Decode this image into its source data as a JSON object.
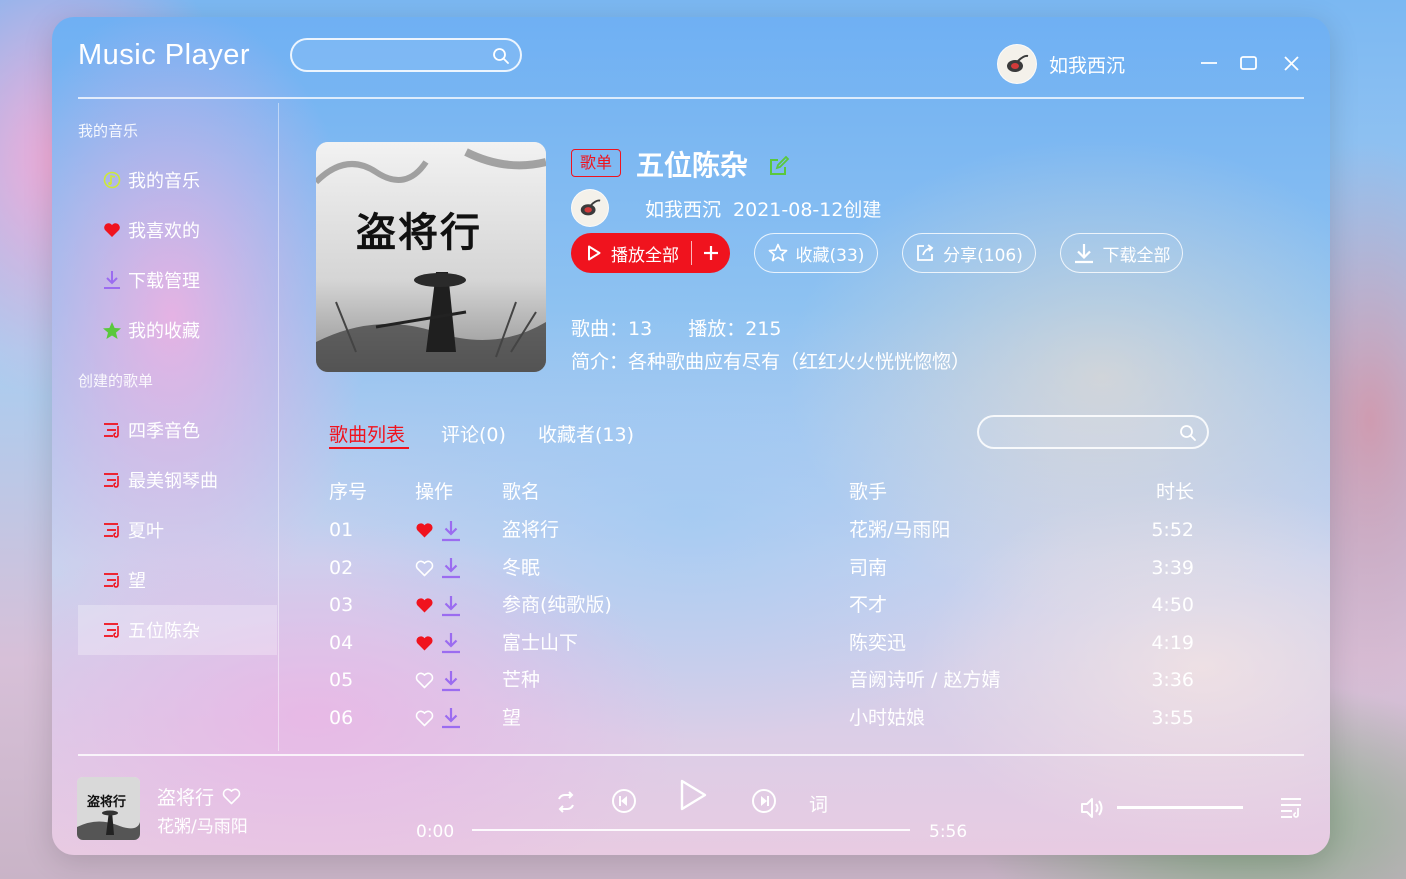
{
  "app": {
    "title": "Music Player"
  },
  "search": {
    "placeholder": ""
  },
  "user": {
    "name": "如我西沉"
  },
  "sidebar": {
    "my_music_title": "我的音乐",
    "items": [
      {
        "label": "我的音乐",
        "icon": "music-note-icon"
      },
      {
        "label": "我喜欢的",
        "icon": "heart-icon"
      },
      {
        "label": "下载管理",
        "icon": "download-icon"
      },
      {
        "label": "我的收藏",
        "icon": "star-icon"
      }
    ],
    "created_title": "创建的歌单",
    "playlists": [
      {
        "label": "四季音色"
      },
      {
        "label": "最美钢琴曲"
      },
      {
        "label": "夏叶"
      },
      {
        "label": "望"
      },
      {
        "label": "五位陈杂",
        "active": true
      }
    ]
  },
  "playlist": {
    "tag": "歌单",
    "title": "五位陈杂",
    "creator": "如我西沉",
    "created": "2021-08-12创建",
    "cover_text": "盗将行",
    "play_all": "播放全部",
    "collect": "收藏(33)",
    "share": "分享(106)",
    "download_all": "下载全部",
    "songs_label": "歌曲：13",
    "plays_label": "播放：215",
    "intro": "简介：各种歌曲应有尽有（红红火火恍恍惚惚）"
  },
  "tabs": [
    {
      "label": "歌曲列表",
      "active": true
    },
    {
      "label": "评论(0)"
    },
    {
      "label": "收藏者(13)"
    }
  ],
  "table": {
    "headers": {
      "no": "序号",
      "op": "操作",
      "name": "歌名",
      "artist": "歌手",
      "duration": "时长"
    },
    "rows": [
      {
        "no": "01",
        "liked": true,
        "name": "盗将行",
        "artist": "花粥/马雨阳",
        "duration": "5:52"
      },
      {
        "no": "02",
        "liked": false,
        "name": "冬眠",
        "artist": "司南",
        "duration": "3:39"
      },
      {
        "no": "03",
        "liked": true,
        "name": "参商(纯歌版)",
        "artist": "不才",
        "duration": "4:50"
      },
      {
        "no": "04",
        "liked": true,
        "name": "富士山下",
        "artist": "陈奕迅",
        "duration": "4:19"
      },
      {
        "no": "05",
        "liked": false,
        "name": "芒种",
        "artist": "音阙诗听 / 赵方婧",
        "duration": "3:36"
      },
      {
        "no": "06",
        "liked": false,
        "name": "望",
        "artist": "小时姑娘",
        "duration": "3:55"
      }
    ]
  },
  "player": {
    "song": "盗将行",
    "artist": "花粥/马雨阳",
    "cover_text": "盗将行",
    "current_time": "0:00",
    "total_time": "5:56",
    "lyric_label": "词",
    "progress": 0,
    "volume": 1
  },
  "colors": {
    "accent": "#f0131e",
    "heart": "#f0131e",
    "download": "#9b6cf0",
    "star": "#5ac83c"
  }
}
